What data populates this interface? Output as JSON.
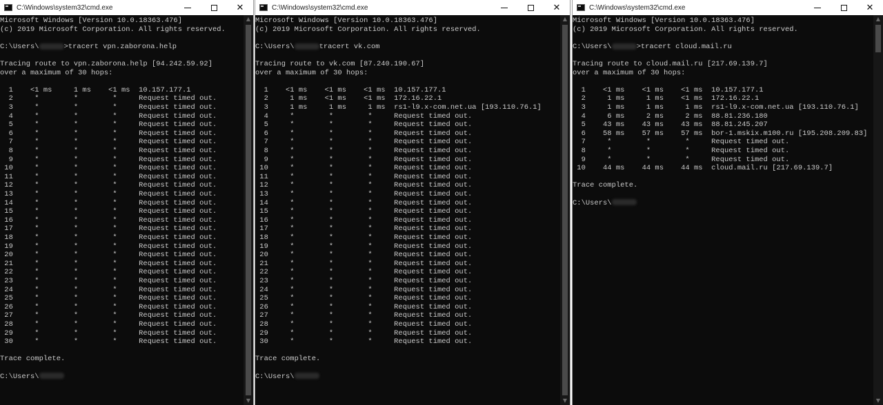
{
  "windows": [
    {
      "title": "C:\\Windows\\system32\\cmd.exe",
      "header": [
        "Microsoft Windows [Version 10.0.18363.476]",
        "(c) 2019 Microsoft Corporation. All rights reserved."
      ],
      "prompt_prefix": "C:\\Users\\",
      "command": ">tracert vpn.zaborona.help",
      "trace_info": [
        "Tracing route to vpn.zaborona.help [94.242.59.92]",
        "over a maximum of 30 hops:"
      ],
      "hops": [
        "  1    <1 ms     1 ms    <1 ms  10.157.177.1",
        "  2     *        *        *     Request timed out.",
        "  3     *        *        *     Request timed out.",
        "  4     *        *        *     Request timed out.",
        "  5     *        *        *     Request timed out.",
        "  6     *        *        *     Request timed out.",
        "  7     *        *        *     Request timed out.",
        "  8     *        *        *     Request timed out.",
        "  9     *        *        *     Request timed out.",
        " 10     *        *        *     Request timed out.",
        " 11     *        *        *     Request timed out.",
        " 12     *        *        *     Request timed out.",
        " 13     *        *        *     Request timed out.",
        " 14     *        *        *     Request timed out.",
        " 15     *        *        *     Request timed out.",
        " 16     *        *        *     Request timed out.",
        " 17     *        *        *     Request timed out.",
        " 18     *        *        *     Request timed out.",
        " 19     *        *        *     Request timed out.",
        " 20     *        *        *     Request timed out.",
        " 21     *        *        *     Request timed out.",
        " 22     *        *        *     Request timed out.",
        " 23     *        *        *     Request timed out.",
        " 24     *        *        *     Request timed out.",
        " 25     *        *        *     Request timed out.",
        " 26     *        *        *     Request timed out.",
        " 27     *        *        *     Request timed out.",
        " 28     *        *        *     Request timed out.",
        " 29     *        *        *     Request timed out.",
        " 30     *        *        *     Request timed out."
      ],
      "complete": "Trace complete.",
      "final_prompt": "C:\\Users\\"
    },
    {
      "title": "C:\\Windows\\system32\\cmd.exe",
      "header": [
        "Microsoft Windows [Version 10.0.18363.476]",
        "(c) 2019 Microsoft Corporation. All rights reserved."
      ],
      "prompt_prefix": "C:\\Users\\",
      "command": "tracert vk.com",
      "trace_info": [
        "Tracing route to vk.com [87.240.190.67]",
        "over a maximum of 30 hops:"
      ],
      "hops": [
        "  1    <1 ms    <1 ms    <1 ms  10.157.177.1",
        "  2     1 ms    <1 ms    <1 ms  172.16.22.1",
        "  3     1 ms     1 ms     1 ms  rs1-l9.x-com.net.ua [193.110.76.1]",
        "  4     *        *        *     Request timed out.",
        "  5     *        *        *     Request timed out.",
        "  6     *        *        *     Request timed out.",
        "  7     *        *        *     Request timed out.",
        "  8     *        *        *     Request timed out.",
        "  9     *        *        *     Request timed out.",
        " 10     *        *        *     Request timed out.",
        " 11     *        *        *     Request timed out.",
        " 12     *        *        *     Request timed out.",
        " 13     *        *        *     Request timed out.",
        " 14     *        *        *     Request timed out.",
        " 15     *        *        *     Request timed out.",
        " 16     *        *        *     Request timed out.",
        " 17     *        *        *     Request timed out.",
        " 18     *        *        *     Request timed out.",
        " 19     *        *        *     Request timed out.",
        " 20     *        *        *     Request timed out.",
        " 21     *        *        *     Request timed out.",
        " 22     *        *        *     Request timed out.",
        " 23     *        *        *     Request timed out.",
        " 24     *        *        *     Request timed out.",
        " 25     *        *        *     Request timed out.",
        " 26     *        *        *     Request timed out.",
        " 27     *        *        *     Request timed out.",
        " 28     *        *        *     Request timed out.",
        " 29     *        *        *     Request timed out.",
        " 30     *        *        *     Request timed out."
      ],
      "complete": "Trace complete.",
      "final_prompt": "C:\\Users\\"
    },
    {
      "title": "C:\\Windows\\system32\\cmd.exe",
      "header": [
        "Microsoft Windows [Version 10.0.18363.476]",
        "(c) 2019 Microsoft Corporation. All rights reserved."
      ],
      "prompt_prefix": "C:\\Users\\",
      "command": ">tracert cloud.mail.ru",
      "trace_info": [
        "Tracing route to cloud.mail.ru [217.69.139.7]",
        "over a maximum of 30 hops:"
      ],
      "hops": [
        "  1    <1 ms    <1 ms    <1 ms  10.157.177.1",
        "  2     1 ms     1 ms    <1 ms  172.16.22.1",
        "  3     1 ms     1 ms     1 ms  rs1-l9.x-com.net.ua [193.110.76.1]",
        "  4     6 ms     2 ms     2 ms  88.81.236.180",
        "  5    43 ms    43 ms    43 ms  88.81.245.207",
        "  6    58 ms    57 ms    57 ms  bor-1.mskix.m100.ru [195.208.209.83]",
        "  7     *        *        *     Request timed out.",
        "  8     *        *        *     Request timed out.",
        "  9     *        *        *     Request timed out.",
        " 10    44 ms    44 ms    44 ms  cloud.mail.ru [217.69.139.7]"
      ],
      "complete": "Trace complete.",
      "final_prompt": "C:\\Users\\"
    }
  ],
  "window_controls": {
    "minimize": "minimize-icon",
    "maximize": "maximize-icon",
    "close": "close-icon"
  },
  "colors": {
    "console_bg": "#0c0c0c",
    "console_text": "#cccccc",
    "titlebar_bg": "#ffffff"
  }
}
